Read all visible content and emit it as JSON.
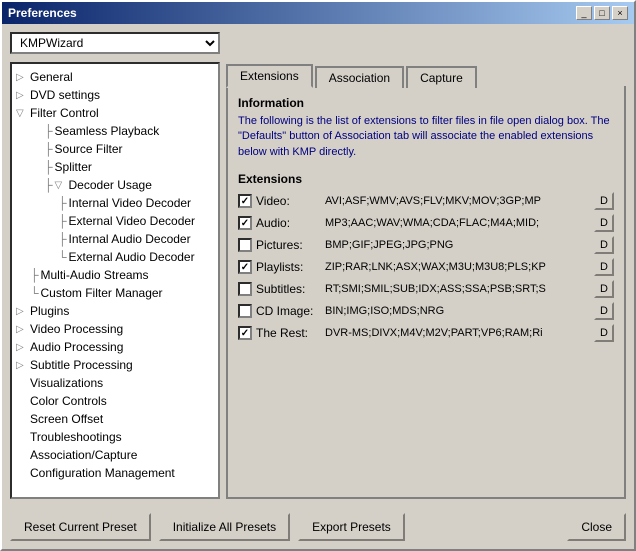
{
  "window": {
    "title": "Preferences",
    "close_btn": "×",
    "minimize_btn": "_",
    "maximize_btn": "□"
  },
  "dropdown": {
    "value": "KMPWizard"
  },
  "tree": {
    "items": [
      {
        "id": "general",
        "label": "General",
        "level": 0,
        "expand": "▷"
      },
      {
        "id": "dvd",
        "label": "DVD settings",
        "level": 0,
        "expand": "▷"
      },
      {
        "id": "filter",
        "label": "Filter Control",
        "level": 0,
        "expand": "▽"
      },
      {
        "id": "seamless",
        "label": "Seamless Playback",
        "level": 2,
        "expand": ""
      },
      {
        "id": "source",
        "label": "Source Filter",
        "level": 2,
        "expand": ""
      },
      {
        "id": "splitter",
        "label": "Splitter",
        "level": 2,
        "expand": ""
      },
      {
        "id": "decoder",
        "label": "Decoder Usage",
        "level": 2,
        "expand": "▽"
      },
      {
        "id": "internal_video",
        "label": "Internal Video Decoder",
        "level": 3,
        "expand": ""
      },
      {
        "id": "external_video",
        "label": "External Video Decoder",
        "level": 3,
        "expand": ""
      },
      {
        "id": "internal_audio",
        "label": "Internal Audio Decoder",
        "level": 3,
        "expand": ""
      },
      {
        "id": "external_audio",
        "label": "External Audio Decoder",
        "level": 3,
        "expand": ""
      },
      {
        "id": "multi_audio",
        "label": "Multi-Audio Streams",
        "level": 1,
        "expand": ""
      },
      {
        "id": "custom_filter",
        "label": "Custom Filter Manager",
        "level": 1,
        "expand": ""
      },
      {
        "id": "plugins",
        "label": "Plugins",
        "level": 0,
        "expand": "▷"
      },
      {
        "id": "video_proc",
        "label": "Video Processing",
        "level": 0,
        "expand": "▷"
      },
      {
        "id": "audio_proc",
        "label": "Audio Processing",
        "level": 0,
        "expand": "▷"
      },
      {
        "id": "subtitle_proc",
        "label": "Subtitle Processing",
        "level": 0,
        "expand": "▷"
      },
      {
        "id": "visualizations",
        "label": "Visualizations",
        "level": 0,
        "expand": ""
      },
      {
        "id": "color_controls",
        "label": "Color Controls",
        "level": 0,
        "expand": ""
      },
      {
        "id": "screen_offset",
        "label": "Screen Offset",
        "level": 0,
        "expand": ""
      },
      {
        "id": "troubleshootings",
        "label": "Troubleshootings",
        "level": 0,
        "expand": ""
      },
      {
        "id": "assoc_capture",
        "label": "Association/Capture",
        "level": 0,
        "expand": ""
      },
      {
        "id": "config_mgmt",
        "label": "Configuration Management",
        "level": 0,
        "expand": ""
      }
    ]
  },
  "tabs": [
    {
      "id": "extensions",
      "label": "Extensions",
      "active": true
    },
    {
      "id": "association",
      "label": "Association"
    },
    {
      "id": "capture",
      "label": "Capture"
    }
  ],
  "content": {
    "info_title": "Information",
    "info_text": "The following is the list of extensions to filter files in file open dialog box. The \"Defaults\" button of Association tab will associate the enabled extensions below with KMP directly.",
    "extensions_title": "Extensions",
    "rows": [
      {
        "label": "Video:",
        "checked": true,
        "value": "AVI;ASF;WMV;AVS;FLV;MKV;MOV;3GP;MP"
      },
      {
        "label": "Audio:",
        "checked": true,
        "value": "MP3;AAC;WAV;WMA;CDA;FLAC;M4A;MID;"
      },
      {
        "label": "Pictures:",
        "checked": false,
        "value": "BMP;GIF;JPEG;JPG;PNG"
      },
      {
        "label": "Playlists:",
        "checked": true,
        "value": "ZIP;RAR;LNK;ASX;WAX;M3U;M3U8;PLS;KP"
      },
      {
        "label": "Subtitles:",
        "checked": false,
        "value": "RT;SMI;SMIL;SUB;IDX;ASS;SSA;PSB;SRT;S"
      },
      {
        "label": "CD Image:",
        "checked": false,
        "value": "BIN;IMG;ISO;MDS;NRG"
      },
      {
        "label": "The Rest:",
        "checked": true,
        "value": "DVR-MS;DIVX;M4V;M2V;PART;VP6;RAM;Ri"
      }
    ],
    "d_btn_label": "D"
  },
  "buttons": {
    "reset": "Reset Current Preset",
    "initialize": "Initialize All Presets",
    "export": "Export Presets",
    "close": "Close"
  }
}
